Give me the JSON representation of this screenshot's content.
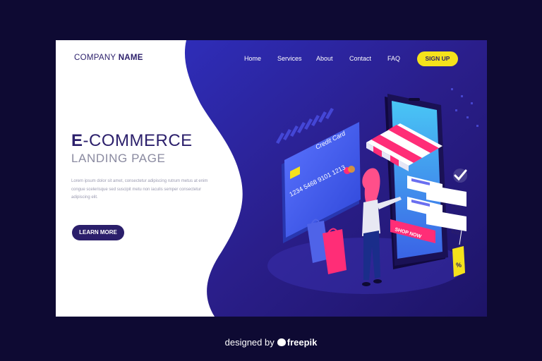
{
  "header": {
    "logo_light": "COMPANY ",
    "logo_bold": "NAME",
    "nav": [
      "Home",
      "Services",
      "About",
      "Contact",
      "FAQ"
    ],
    "signup_label": "SIGN UP"
  },
  "hero": {
    "title_bold": "E",
    "title_rest": "-COMMERCE",
    "subtitle": "LANDING PAGE",
    "body": "Lorem ipsum dolor sit amet, consectetur adipiscing rutrum metus at enim congue scelerisque sed suscipit metu non iaculis semper consectetur adipiscing elit.",
    "button_label": "LEARN MORE"
  },
  "illustration": {
    "card_label": "Credit Card",
    "card_number": "1234 5468 9101 1213",
    "price_1": "$100",
    "price_2": "$100",
    "shop_now": "SHOP NOW",
    "tag_symbol": "%"
  },
  "footer": {
    "credit_prefix": "designed by",
    "credit_brand": "freepik"
  },
  "colors": {
    "navy": "#2b1f6b",
    "accent_yellow": "#f5e21b",
    "purple_dark": "#1f1577",
    "blue": "#4a4fe0",
    "pink": "#ff2d77"
  }
}
